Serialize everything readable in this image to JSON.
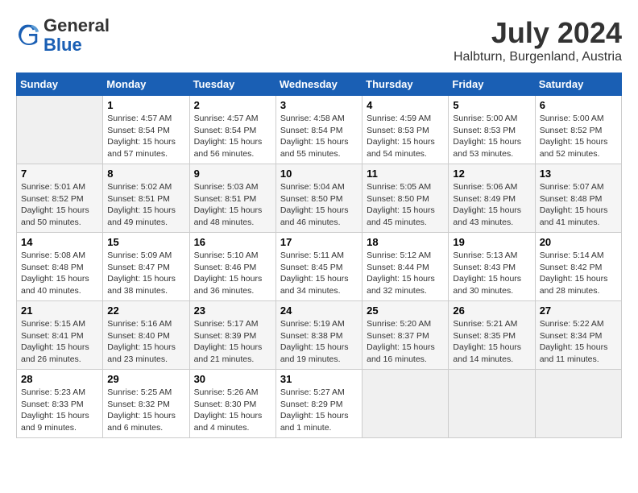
{
  "header": {
    "logo_general": "General",
    "logo_blue": "Blue",
    "month_year": "July 2024",
    "location": "Halbturn, Burgenland, Austria"
  },
  "columns": [
    "Sunday",
    "Monday",
    "Tuesday",
    "Wednesday",
    "Thursday",
    "Friday",
    "Saturday"
  ],
  "weeks": [
    [
      {
        "day": "",
        "sunrise": "",
        "sunset": "",
        "daylight": "",
        "empty": true
      },
      {
        "day": "1",
        "sunrise": "Sunrise: 4:57 AM",
        "sunset": "Sunset: 8:54 PM",
        "daylight": "Daylight: 15 hours and 57 minutes."
      },
      {
        "day": "2",
        "sunrise": "Sunrise: 4:57 AM",
        "sunset": "Sunset: 8:54 PM",
        "daylight": "Daylight: 15 hours and 56 minutes."
      },
      {
        "day": "3",
        "sunrise": "Sunrise: 4:58 AM",
        "sunset": "Sunset: 8:54 PM",
        "daylight": "Daylight: 15 hours and 55 minutes."
      },
      {
        "day": "4",
        "sunrise": "Sunrise: 4:59 AM",
        "sunset": "Sunset: 8:53 PM",
        "daylight": "Daylight: 15 hours and 54 minutes."
      },
      {
        "day": "5",
        "sunrise": "Sunrise: 5:00 AM",
        "sunset": "Sunset: 8:53 PM",
        "daylight": "Daylight: 15 hours and 53 minutes."
      },
      {
        "day": "6",
        "sunrise": "Sunrise: 5:00 AM",
        "sunset": "Sunset: 8:52 PM",
        "daylight": "Daylight: 15 hours and 52 minutes."
      }
    ],
    [
      {
        "day": "7",
        "sunrise": "Sunrise: 5:01 AM",
        "sunset": "Sunset: 8:52 PM",
        "daylight": "Daylight: 15 hours and 50 minutes."
      },
      {
        "day": "8",
        "sunrise": "Sunrise: 5:02 AM",
        "sunset": "Sunset: 8:51 PM",
        "daylight": "Daylight: 15 hours and 49 minutes."
      },
      {
        "day": "9",
        "sunrise": "Sunrise: 5:03 AM",
        "sunset": "Sunset: 8:51 PM",
        "daylight": "Daylight: 15 hours and 48 minutes."
      },
      {
        "day": "10",
        "sunrise": "Sunrise: 5:04 AM",
        "sunset": "Sunset: 8:50 PM",
        "daylight": "Daylight: 15 hours and 46 minutes."
      },
      {
        "day": "11",
        "sunrise": "Sunrise: 5:05 AM",
        "sunset": "Sunset: 8:50 PM",
        "daylight": "Daylight: 15 hours and 45 minutes."
      },
      {
        "day": "12",
        "sunrise": "Sunrise: 5:06 AM",
        "sunset": "Sunset: 8:49 PM",
        "daylight": "Daylight: 15 hours and 43 minutes."
      },
      {
        "day": "13",
        "sunrise": "Sunrise: 5:07 AM",
        "sunset": "Sunset: 8:48 PM",
        "daylight": "Daylight: 15 hours and 41 minutes."
      }
    ],
    [
      {
        "day": "14",
        "sunrise": "Sunrise: 5:08 AM",
        "sunset": "Sunset: 8:48 PM",
        "daylight": "Daylight: 15 hours and 40 minutes."
      },
      {
        "day": "15",
        "sunrise": "Sunrise: 5:09 AM",
        "sunset": "Sunset: 8:47 PM",
        "daylight": "Daylight: 15 hours and 38 minutes."
      },
      {
        "day": "16",
        "sunrise": "Sunrise: 5:10 AM",
        "sunset": "Sunset: 8:46 PM",
        "daylight": "Daylight: 15 hours and 36 minutes."
      },
      {
        "day": "17",
        "sunrise": "Sunrise: 5:11 AM",
        "sunset": "Sunset: 8:45 PM",
        "daylight": "Daylight: 15 hours and 34 minutes."
      },
      {
        "day": "18",
        "sunrise": "Sunrise: 5:12 AM",
        "sunset": "Sunset: 8:44 PM",
        "daylight": "Daylight: 15 hours and 32 minutes."
      },
      {
        "day": "19",
        "sunrise": "Sunrise: 5:13 AM",
        "sunset": "Sunset: 8:43 PM",
        "daylight": "Daylight: 15 hours and 30 minutes."
      },
      {
        "day": "20",
        "sunrise": "Sunrise: 5:14 AM",
        "sunset": "Sunset: 8:42 PM",
        "daylight": "Daylight: 15 hours and 28 minutes."
      }
    ],
    [
      {
        "day": "21",
        "sunrise": "Sunrise: 5:15 AM",
        "sunset": "Sunset: 8:41 PM",
        "daylight": "Daylight: 15 hours and 26 minutes."
      },
      {
        "day": "22",
        "sunrise": "Sunrise: 5:16 AM",
        "sunset": "Sunset: 8:40 PM",
        "daylight": "Daylight: 15 hours and 23 minutes."
      },
      {
        "day": "23",
        "sunrise": "Sunrise: 5:17 AM",
        "sunset": "Sunset: 8:39 PM",
        "daylight": "Daylight: 15 hours and 21 minutes."
      },
      {
        "day": "24",
        "sunrise": "Sunrise: 5:19 AM",
        "sunset": "Sunset: 8:38 PM",
        "daylight": "Daylight: 15 hours and 19 minutes."
      },
      {
        "day": "25",
        "sunrise": "Sunrise: 5:20 AM",
        "sunset": "Sunset: 8:37 PM",
        "daylight": "Daylight: 15 hours and 16 minutes."
      },
      {
        "day": "26",
        "sunrise": "Sunrise: 5:21 AM",
        "sunset": "Sunset: 8:35 PM",
        "daylight": "Daylight: 15 hours and 14 minutes."
      },
      {
        "day": "27",
        "sunrise": "Sunrise: 5:22 AM",
        "sunset": "Sunset: 8:34 PM",
        "daylight": "Daylight: 15 hours and 11 minutes."
      }
    ],
    [
      {
        "day": "28",
        "sunrise": "Sunrise: 5:23 AM",
        "sunset": "Sunset: 8:33 PM",
        "daylight": "Daylight: 15 hours and 9 minutes."
      },
      {
        "day": "29",
        "sunrise": "Sunrise: 5:25 AM",
        "sunset": "Sunset: 8:32 PM",
        "daylight": "Daylight: 15 hours and 6 minutes."
      },
      {
        "day": "30",
        "sunrise": "Sunrise: 5:26 AM",
        "sunset": "Sunset: 8:30 PM",
        "daylight": "Daylight: 15 hours and 4 minutes."
      },
      {
        "day": "31",
        "sunrise": "Sunrise: 5:27 AM",
        "sunset": "Sunset: 8:29 PM",
        "daylight": "Daylight: 15 hours and 1 minute."
      },
      {
        "day": "",
        "sunrise": "",
        "sunset": "",
        "daylight": "",
        "empty": true
      },
      {
        "day": "",
        "sunrise": "",
        "sunset": "",
        "daylight": "",
        "empty": true
      },
      {
        "day": "",
        "sunrise": "",
        "sunset": "",
        "daylight": "",
        "empty": true
      }
    ]
  ]
}
